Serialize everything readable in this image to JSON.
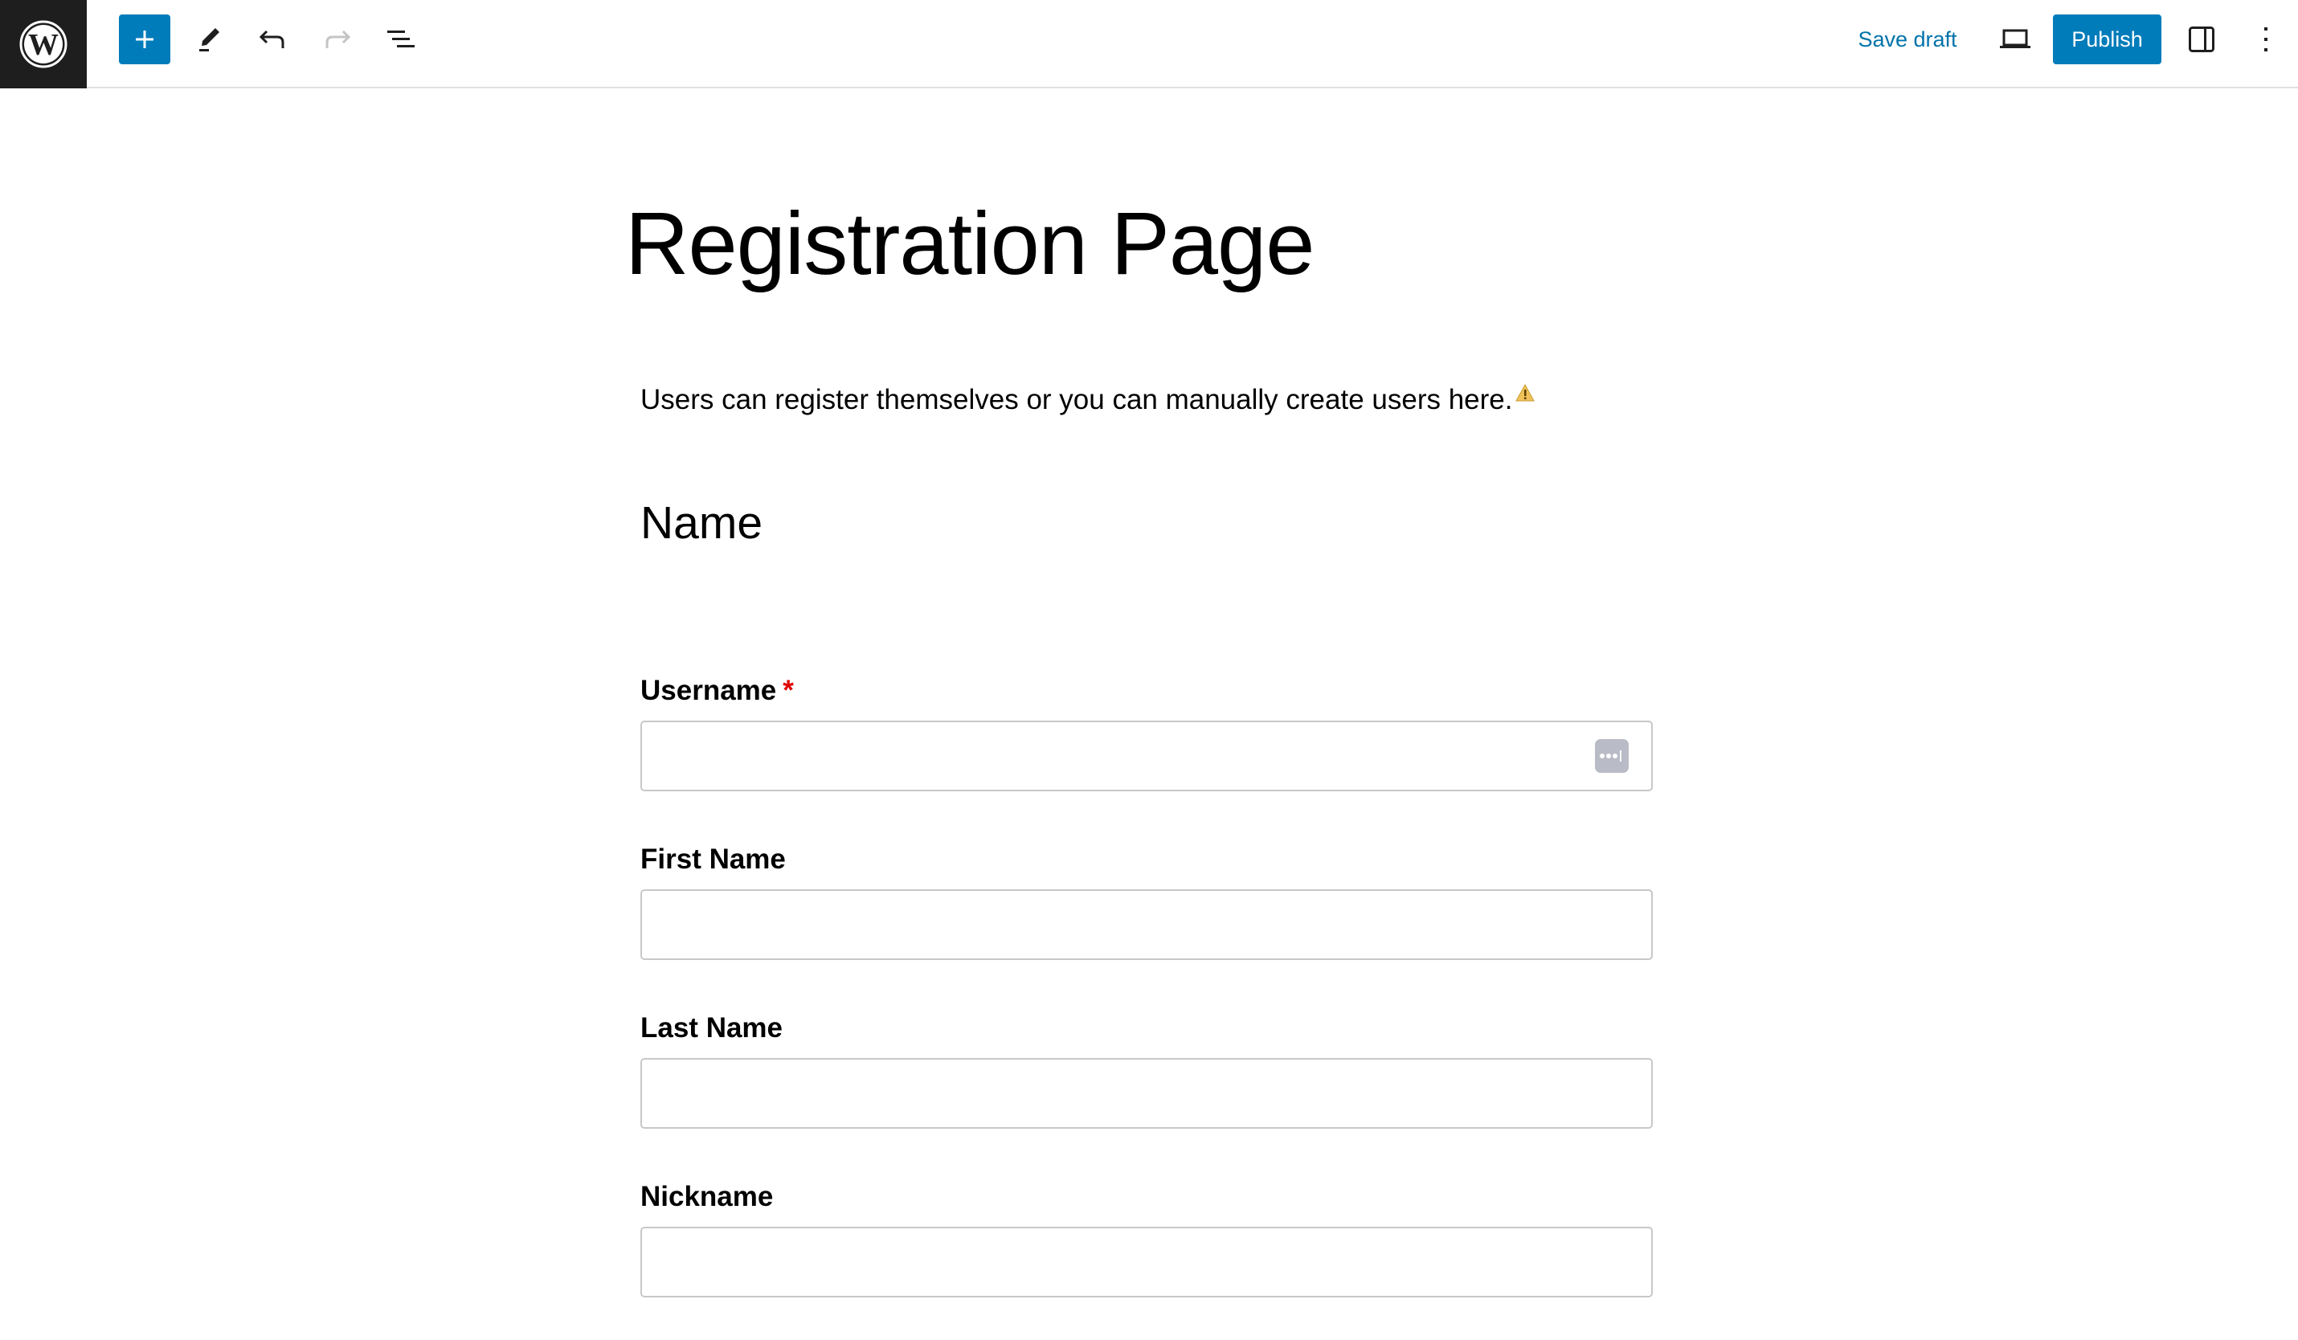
{
  "toolbar": {
    "logo_icon": "wordpress-logo-icon",
    "add_block_icon": "plus-icon",
    "tools_icon": "pencil-icon",
    "undo_icon": "undo-icon",
    "redo_icon": "redo-icon",
    "document_overview_icon": "list-view-icon",
    "save_draft_label": "Save draft",
    "preview_icon": "laptop-icon",
    "publish_label": "Publish",
    "settings_icon": "sidebar-toggle-icon",
    "options_icon": "kebab-menu-icon",
    "colors": {
      "accent": "#007cba",
      "link": "#0073aa",
      "logo_bg": "#1e1e1e"
    }
  },
  "page": {
    "title": "Registration Page",
    "intro": "Users can register themselves or you can manually create users here.",
    "intro_icon": "warning-icon",
    "section_heading": "Name",
    "fields": [
      {
        "label": "Username",
        "required": true,
        "required_mark": "*",
        "value": "",
        "placeholder": "",
        "autofill_icon": "password-manager-icon"
      },
      {
        "label": "First Name",
        "required": false,
        "value": "",
        "placeholder": ""
      },
      {
        "label": "Last Name",
        "required": false,
        "value": "",
        "placeholder": ""
      },
      {
        "label": "Nickname",
        "required": false,
        "value": "",
        "placeholder": ""
      }
    ]
  }
}
